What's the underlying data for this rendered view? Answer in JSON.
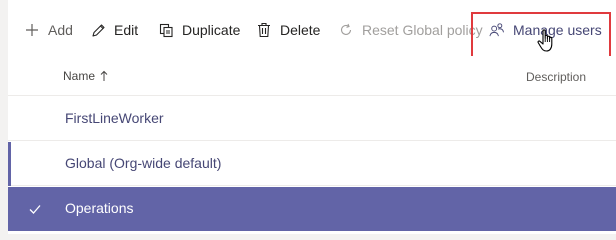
{
  "toolbar": {
    "add_label": "Add",
    "edit_label": "Edit",
    "duplicate_label": "Duplicate",
    "delete_label": "Delete",
    "reset_label": "Reset Global policy",
    "manage_users_label": "Manage users"
  },
  "table": {
    "columns": {
      "name": "Name",
      "description": "Description"
    },
    "sort": "ascending",
    "rows": [
      {
        "name": "FirstLineWorker",
        "selected": false
      },
      {
        "name": "Global (Org-wide default)",
        "selected": false
      },
      {
        "name": "Operations",
        "selected": true
      }
    ]
  },
  "colors": {
    "accent": "#6264a7",
    "highlight_border": "#e03a3e",
    "link_text": "#464775"
  },
  "icons": {
    "add": "plus-icon",
    "edit": "pencil-icon",
    "duplicate": "copy-icon",
    "delete": "trash-icon",
    "reset": "reset-icon",
    "manage_users": "people-icon",
    "sort": "arrow-up-icon",
    "selected": "checkmark-icon",
    "cursor": "hand-pointer-icon"
  }
}
